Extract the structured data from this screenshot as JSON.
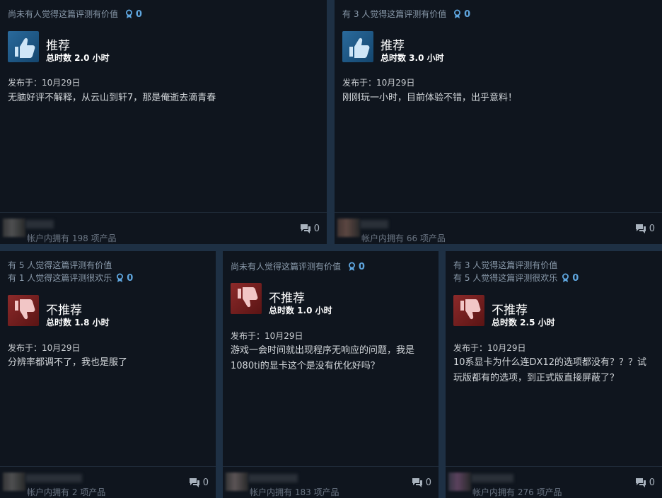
{
  "reviews": [
    {
      "helpful_lines": [
        "尚未有人觉得这篇评测有价值"
      ],
      "awards": "0",
      "verdict": "推荐",
      "hours": "总时数 2.0 小时",
      "posted": "发布于：10月29日",
      "content": "无脑好评不解释，从云山到轩7，那是俺逝去滴青春",
      "owned": "帐户内拥有 198 项产品",
      "comments": "0",
      "type": "recommended"
    },
    {
      "helpful_lines": [
        "有 3 人觉得这篇评测有价值"
      ],
      "awards": "0",
      "verdict": "推荐",
      "hours": "总时数 3.0 小时",
      "posted": "发布于：10月29日",
      "content": "刚刚玩一小时，目前体验不错，出乎意料！",
      "owned": "帐户内拥有 66 项产品",
      "comments": "0",
      "type": "recommended"
    },
    {
      "helpful_lines": [
        "有 5 人觉得这篇评测有价值",
        "有 1 人觉得这篇评测很欢乐"
      ],
      "awards": "0",
      "verdict": "不推荐",
      "hours": "总时数 1.8 小时",
      "posted": "发布于：10月29日",
      "content": "分辨率都调不了，我也是服了",
      "owned": "帐户内拥有 2 项产品",
      "comments": "0",
      "type": "not_recommended"
    },
    {
      "helpful_lines": [
        "尚未有人觉得这篇评测有价值"
      ],
      "awards": "0",
      "verdict": "不推荐",
      "hours": "总时数 1.0 小时",
      "posted": "发布于：10月29日",
      "content": "游戏一会时间就出现程序无响应的问题，我是1080ti的显卡这个是没有优化好吗？",
      "owned": "帐户内拥有 183 项产品",
      "comments": "0",
      "type": "not_recommended"
    },
    {
      "helpful_lines": [
        "有 3 人觉得这篇评测有价值",
        "有 5 人觉得这篇评测很欢乐"
      ],
      "awards": "0",
      "verdict": "不推荐",
      "hours": "总时数 2.5 小时",
      "posted": "发布于：10月29日",
      "content": "10系显卡为什么连DX12的选项都没有？？？试玩版都有的选项，到正式版直接屏蔽了？",
      "owned": "帐户内拥有 276 项产品",
      "comments": "0",
      "type": "not_recommended"
    }
  ],
  "colors": {
    "accent": "#5fa6df",
    "card_bg": "#0f151e",
    "page_bg": "#1e3044",
    "thumb_up": "#2a6a9c",
    "thumb_down": "#8c2a2a"
  }
}
